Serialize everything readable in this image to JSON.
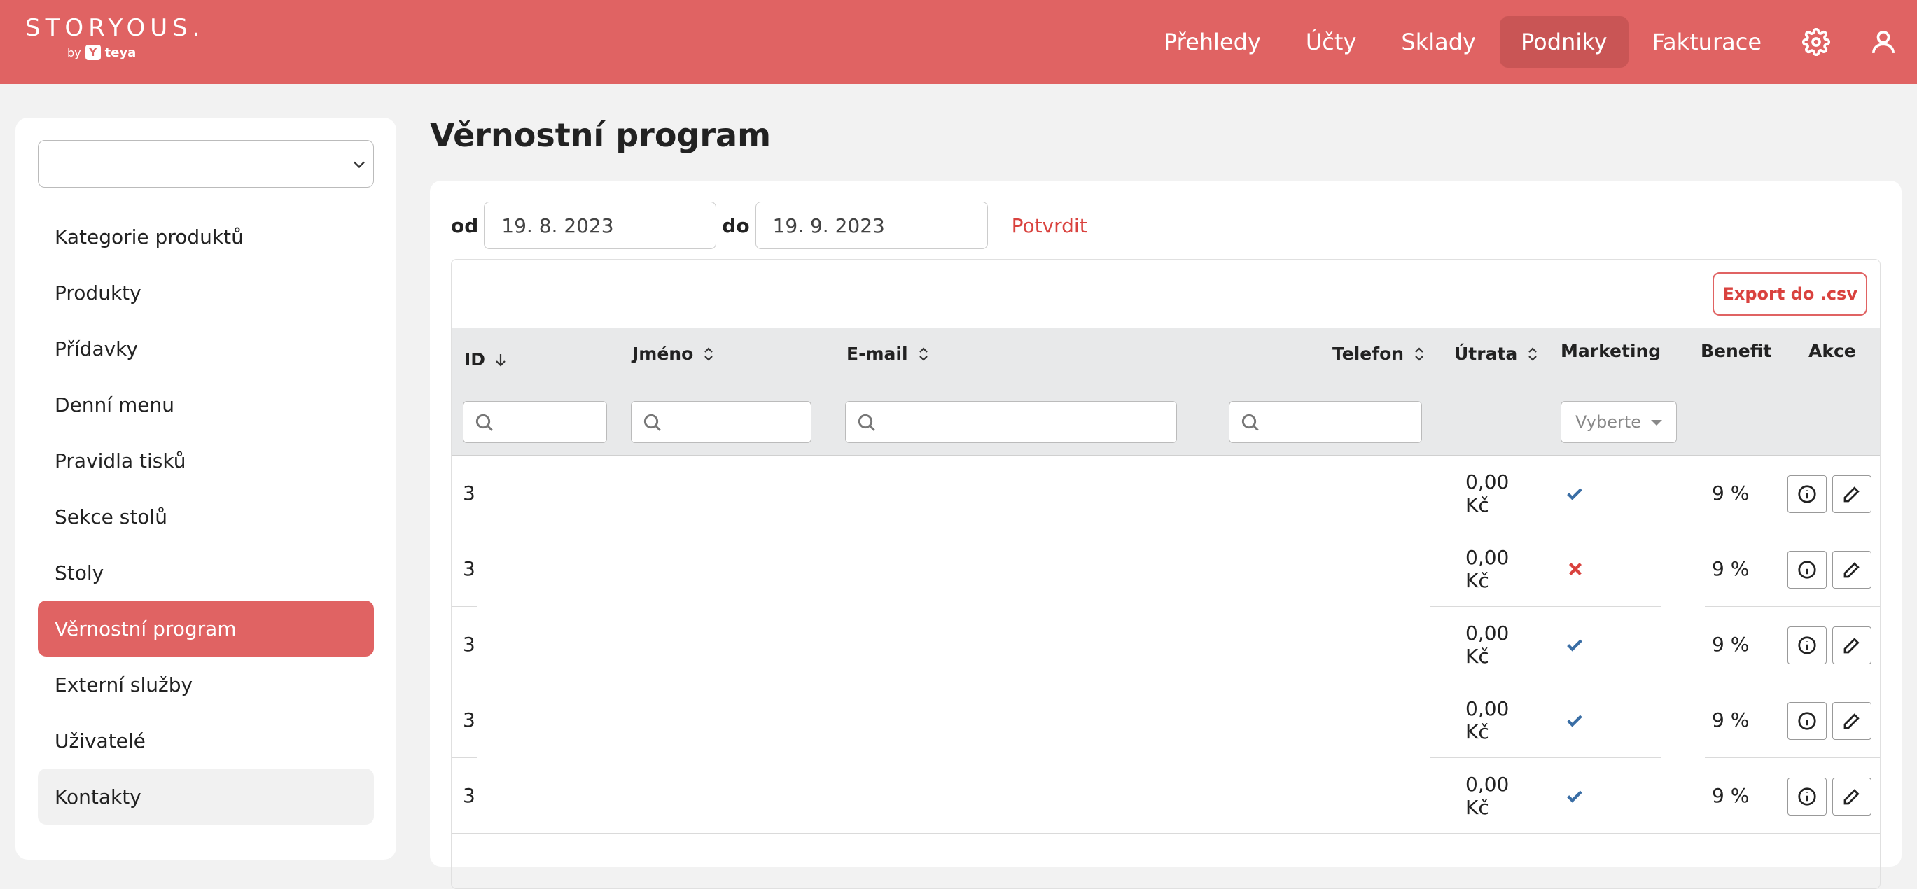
{
  "brand": {
    "name": "STORYOUS.",
    "by": "by",
    "partner": "teya"
  },
  "nav": {
    "items": [
      {
        "label": "Přehledy",
        "active": false
      },
      {
        "label": "Účty",
        "active": false
      },
      {
        "label": "Sklady",
        "active": false
      },
      {
        "label": "Podniky",
        "active": true
      },
      {
        "label": "Fakturace",
        "active": false
      }
    ],
    "icons": [
      "gear-icon",
      "user-icon"
    ]
  },
  "sidebar": {
    "venue_select_value": "",
    "items": [
      {
        "label": "Kategorie produktů"
      },
      {
        "label": "Produkty"
      },
      {
        "label": "Přídavky"
      },
      {
        "label": "Denní menu"
      },
      {
        "label": "Pravidla tisků"
      },
      {
        "label": "Sekce stolů"
      },
      {
        "label": "Stoly"
      },
      {
        "label": "Věrnostní program",
        "active": true
      },
      {
        "label": "Externí služby"
      },
      {
        "label": "Uživatelé"
      },
      {
        "label": "Kontakty",
        "hover": true
      }
    ]
  },
  "page": {
    "title": "Věrnostní program"
  },
  "filters": {
    "from_label": "od",
    "from_value": "19. 8. 2023",
    "to_label": "do",
    "to_value": "19. 9. 2023",
    "confirm_label": "Potvrdit"
  },
  "table": {
    "export_label": "Export do .csv",
    "columns": {
      "id": "ID",
      "name": "Jméno",
      "email": "E-mail",
      "phone": "Telefon",
      "spend": "Útrata",
      "marketing": "Marketing",
      "benefit": "Benefit",
      "actions": "Akce"
    },
    "marketing_filter_placeholder": "Vyberte",
    "rows": [
      {
        "id": "3",
        "spend": "0,00 Kč",
        "marketing": true,
        "benefit": "9 %"
      },
      {
        "id": "3",
        "spend": "0,00 Kč",
        "marketing": false,
        "benefit": "9 %"
      },
      {
        "id": "3",
        "spend": "0,00 Kč",
        "marketing": true,
        "benefit": "9 %"
      },
      {
        "id": "3",
        "spend": "0,00 Kč",
        "marketing": true,
        "benefit": "9 %"
      },
      {
        "id": "3",
        "spend": "0,00 Kč",
        "marketing": true,
        "benefit": "9 %"
      }
    ]
  },
  "colors": {
    "brand": "#e06363",
    "brand_dark": "#c95555",
    "accent_text": "#d9423e",
    "check": "#3a6ea5"
  }
}
